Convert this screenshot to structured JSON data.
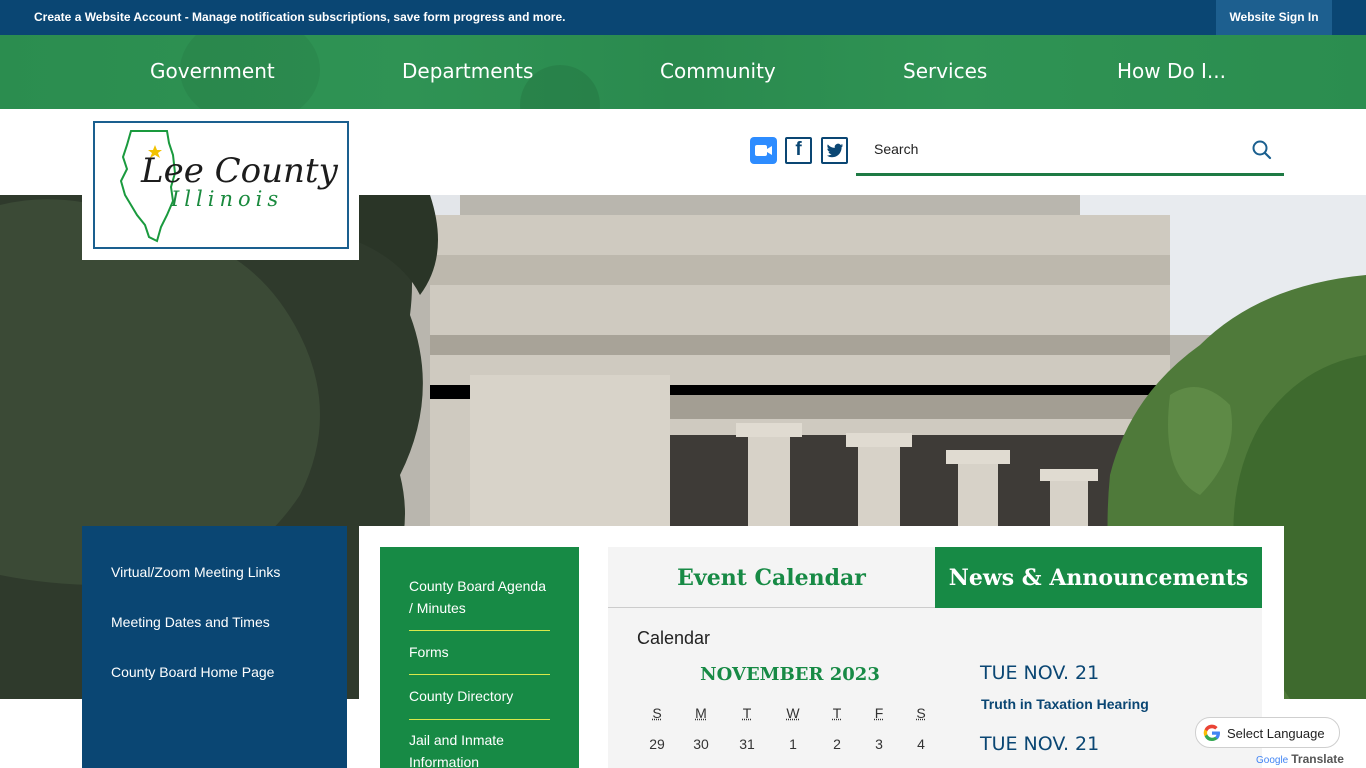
{
  "topbar": {
    "create_account_link": "Create a Website Account",
    "message_rest": " - Manage notification subscriptions, save form progress and more.",
    "sign_in": "Website Sign In"
  },
  "nav": {
    "items": [
      "Government",
      "Departments",
      "Community",
      "Services",
      "How Do I..."
    ]
  },
  "logo": {
    "title": "Lee County",
    "subtitle": "Illinois"
  },
  "social": {
    "zoom": "zoom-icon",
    "facebook": "facebook-icon",
    "twitter": "twitter-icon",
    "facebook_glyph": "f"
  },
  "search": {
    "placeholder": "Search"
  },
  "quick_links": [
    "Virtual/Zoom Meeting Links",
    "Meeting Dates and Times",
    "County Board Home Page"
  ],
  "green_links": [
    "County Board Agenda / Minutes",
    "Forms",
    "County Directory",
    "Jail and Inmate Information"
  ],
  "tabs": {
    "event_calendar": "Event Calendar",
    "news": "News & Announcements"
  },
  "calendar": {
    "heading": "Calendar",
    "month": "NOVEMBER 2023",
    "days_of_week": [
      "S",
      "M",
      "T",
      "W",
      "T",
      "F",
      "S"
    ],
    "first_row": [
      "29",
      "30",
      "31",
      "1",
      "2",
      "3",
      "4"
    ]
  },
  "events": [
    {
      "date": "TUE NOV. 21",
      "title": "Truth in Taxation Hearing"
    },
    {
      "date": "TUE NOV. 21",
      "title": ""
    }
  ],
  "translate": {
    "label": "Select Language",
    "powered_by": "Google",
    "translate_word": "Translate"
  },
  "colors": {
    "navy": "#0a4673",
    "green": "#178a45",
    "accent_line": "#d9e84a"
  }
}
